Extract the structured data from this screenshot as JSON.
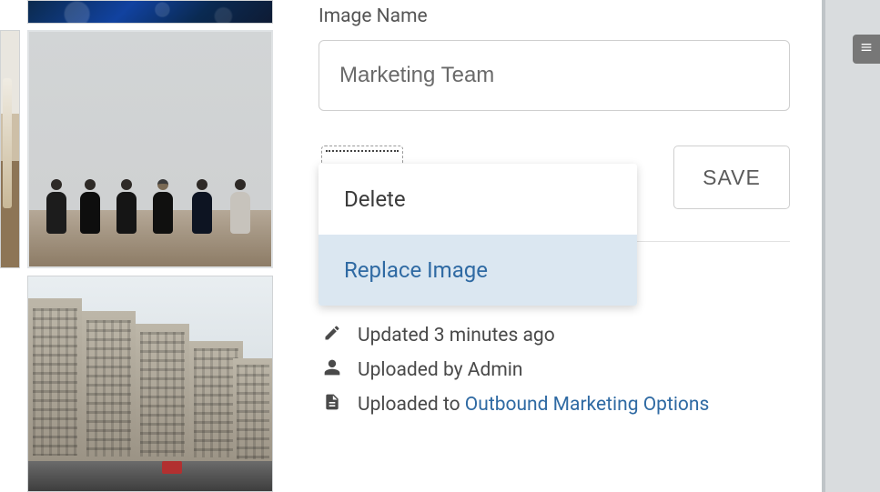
{
  "form": {
    "name_label": "Image Name",
    "name_value": "Marketing Team",
    "save_label": "SAVE"
  },
  "menu": {
    "delete_label": "Delete",
    "replace_label": "Replace Image"
  },
  "meta": {
    "updated_text": "Updated 3 minutes ago",
    "uploader_prefix": "Uploaded by ",
    "uploader_name": "Admin",
    "location_prefix": "Uploaded to ",
    "location_link": "Outbound Marketing Options"
  }
}
